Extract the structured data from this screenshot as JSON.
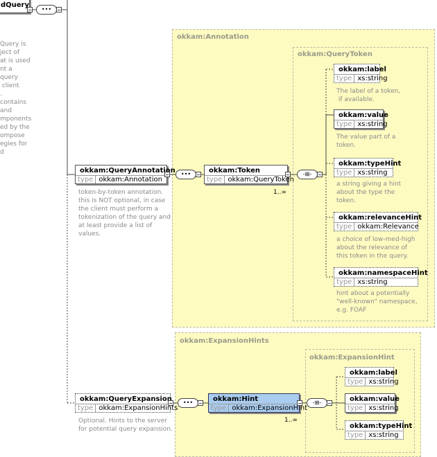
{
  "root_element": {
    "name": "dQuery"
  },
  "root_description": [
    "Query is",
    "ject of",
    "at is used",
    "nt a",
    "query",
    " client",
    ".",
    "contains",
    "and",
    "mponents",
    "ed by the",
    "ompose",
    "egies for",
    "d"
  ],
  "regions": {
    "annotation_type": "okkam:Annotation",
    "query_token_type": "okkam:QueryToken",
    "expansion_hints_type": "okkam:ExpansionHints",
    "expansion_hint_type": "okkam:ExpansionHint"
  },
  "type_label": "type",
  "query_annotation": {
    "name": "okkam:QueryAnnotation",
    "type": "okkam:Annotation",
    "description": "token-by-token annotation.\nthis is NOT optional, in case\nthe client must perform a\ntokenization of the query and\nat least provide a list of\nvalues."
  },
  "token": {
    "name": "okkam:Token",
    "type": "okkam:QueryToken",
    "cardinality": "1..∞"
  },
  "token_children": [
    {
      "name": "okkam:label",
      "type": "xs:string",
      "optional": true,
      "description": "The label of a token,\n if available."
    },
    {
      "name": "okkam:value",
      "type": "xs:string",
      "optional": false,
      "description": "The value part of a\ntoken."
    },
    {
      "name": "okkam:typeHint",
      "type": "xs:string",
      "optional": true,
      "description": "a string giving a hint\nabout the type the\ntoken."
    },
    {
      "name": "okkam:relevanceHint",
      "type": "okkam:Relevance",
      "optional": true,
      "description": "a choice of low-med-high\nabout the relevance of\nthis token in the query."
    },
    {
      "name": "okkam:namespaceHint",
      "type": "xs:string",
      "optional": true,
      "description": "hint about a potentially\n\"well-known\" namespace,\ne.g. FOAF"
    }
  ],
  "query_expansion": {
    "name": "okkam:QueryExpansion",
    "type": "okkam:ExpansionHints",
    "optional": true,
    "description": "Optional. Hints to the server\nfor potential query expansion."
  },
  "hint": {
    "name": "okkam:Hint",
    "type": "okkam:ExpansionHint",
    "cardinality": "1..∞",
    "selected": true
  },
  "hint_children": [
    {
      "name": "okkam:label",
      "type": "xs:string",
      "optional": true
    },
    {
      "name": "okkam:value",
      "type": "xs:string",
      "optional": false
    },
    {
      "name": "okkam:typeHint",
      "type": "xs:string",
      "optional": true
    }
  ],
  "compositor_icons": {
    "sequence": "sequence-icon",
    "all": "all-icon"
  },
  "colors": {
    "region_fill": "#fdfbc0",
    "selected_fill": "#a9ccef"
  }
}
